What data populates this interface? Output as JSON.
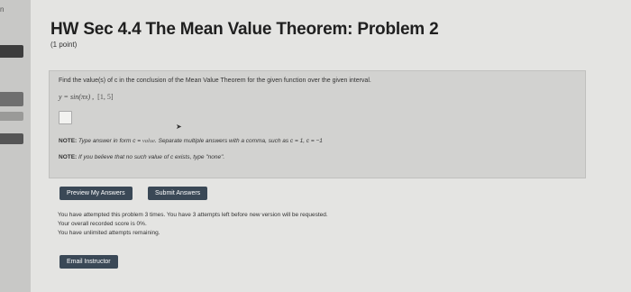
{
  "rail": {
    "mark": "n"
  },
  "header": {
    "title": "HW Sec 4.4 The Mean Value Theorem: Problem 2",
    "points": "(1 point)"
  },
  "problem": {
    "instructions": "Find the value(s) of c in the conclusion of the Mean Value Theorem for the given function over the given interval.",
    "equation": "y = sin(πx)",
    "interval": "[1, 5]",
    "answer_value": "",
    "note1_label": "NOTE:",
    "note1_text": "Type answer in form c = ",
    "note1_value": "value",
    "note1_rest": ". Separate multiple answers with a comma, such as c = 1, c = −1",
    "note2_label": "NOTE:",
    "note2_text": "If you believe that no such value of c exists, type \"none\"."
  },
  "buttons": {
    "preview": "Preview My Answers",
    "submit": "Submit Answers",
    "email": "Email Instructor"
  },
  "status": {
    "line1": "You have attempted this problem 3 times. You have 3 attempts left before new version will be requested.",
    "line2": "Your overall recorded score is 0%.",
    "line3": "You have unlimited attempts remaining."
  }
}
